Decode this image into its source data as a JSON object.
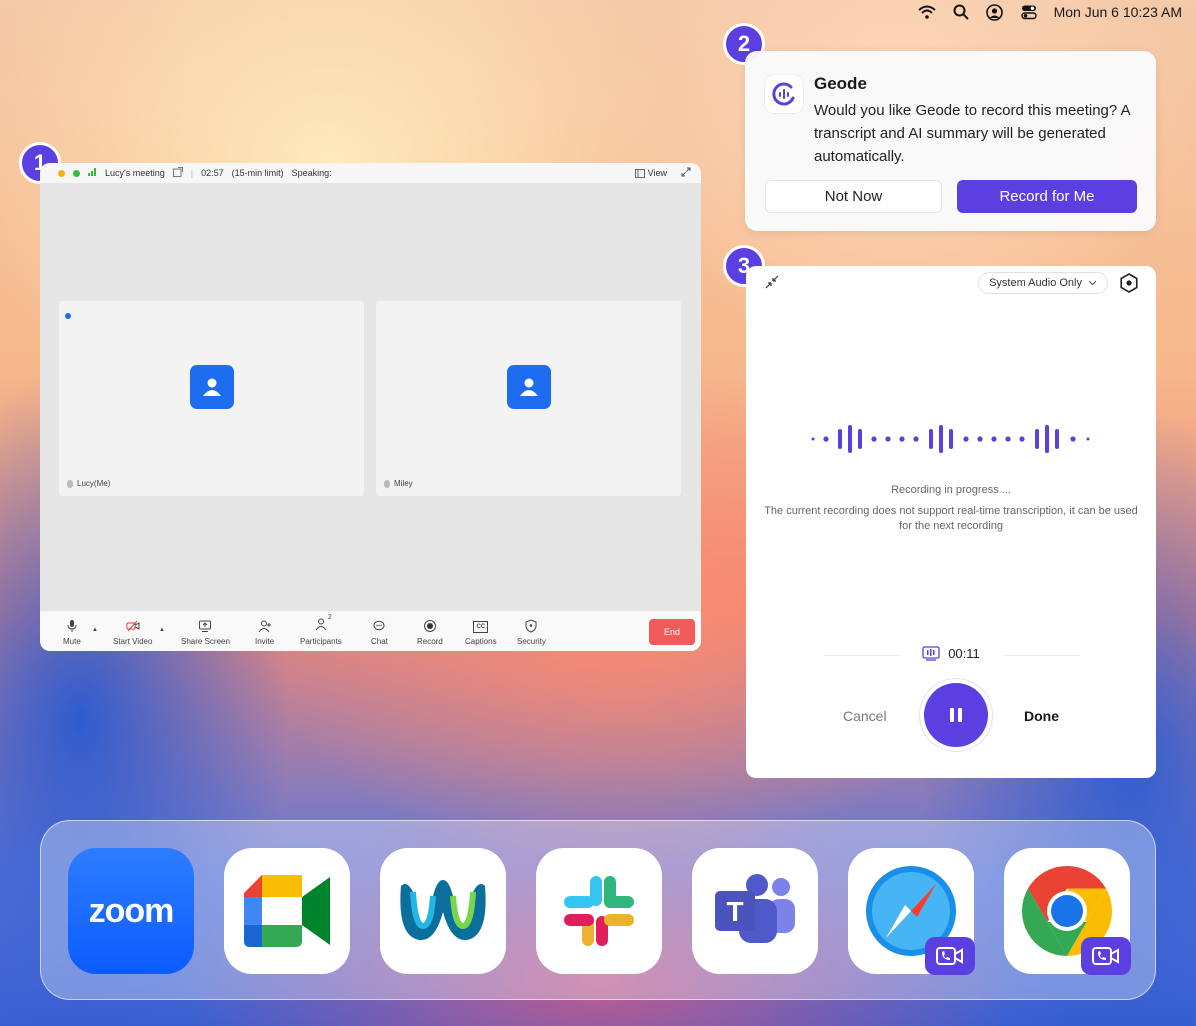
{
  "menubar": {
    "icons": [
      "wifi-icon",
      "search-icon",
      "user-circle-icon",
      "control-center-icon"
    ],
    "clock": "Mon Jun 6  10:23 AM"
  },
  "badges": [
    "1",
    "2",
    "3"
  ],
  "zoom": {
    "meeting_title": "Lucy's meeting",
    "elapsed": "02:57",
    "limit": "(15-min limit)",
    "speaking": "Speaking:",
    "view_label": "View",
    "participants": [
      {
        "name": "Lucy(Me)"
      },
      {
        "name": "Miley"
      }
    ],
    "toolbar": [
      {
        "label": "Mute",
        "icon": "mic-icon"
      },
      {
        "label": "Start Video",
        "icon": "video-off-icon"
      },
      {
        "label": "Share Screen",
        "icon": "share-screen-icon"
      },
      {
        "label": "Invite",
        "icon": "invite-icon"
      },
      {
        "label": "Participants",
        "icon": "participants-icon",
        "count": "2"
      },
      {
        "label": "Chat",
        "icon": "chat-icon"
      },
      {
        "label": "Record",
        "icon": "record-icon"
      },
      {
        "label": "Captions",
        "icon": "captions-icon",
        "glyph": "CC"
      },
      {
        "label": "Security",
        "icon": "shield-icon"
      }
    ],
    "end_label": "End"
  },
  "notification": {
    "app_name": "Geode",
    "message": "Would you like Geode to record this meeting? A transcript and AI summary will be generated automatically.",
    "not_now": "Not Now",
    "record": "Record for Me"
  },
  "recorder": {
    "source": "System Audio Only",
    "status": "Recording in progress ...",
    "note": "The current recording does not support real-time transcription, it can be used for the next recording",
    "timer": "00:11",
    "cancel": "Cancel",
    "done": "Done"
  },
  "dock": {
    "apps": [
      "zoom",
      "google-meet",
      "webex",
      "slack",
      "microsoft-teams",
      "safari",
      "chrome"
    ],
    "zoom_label": "zoom"
  },
  "colors": {
    "accent": "#5b3fe0",
    "zoom_blue": "#1e6cf0",
    "end_red": "#f25b5b"
  }
}
